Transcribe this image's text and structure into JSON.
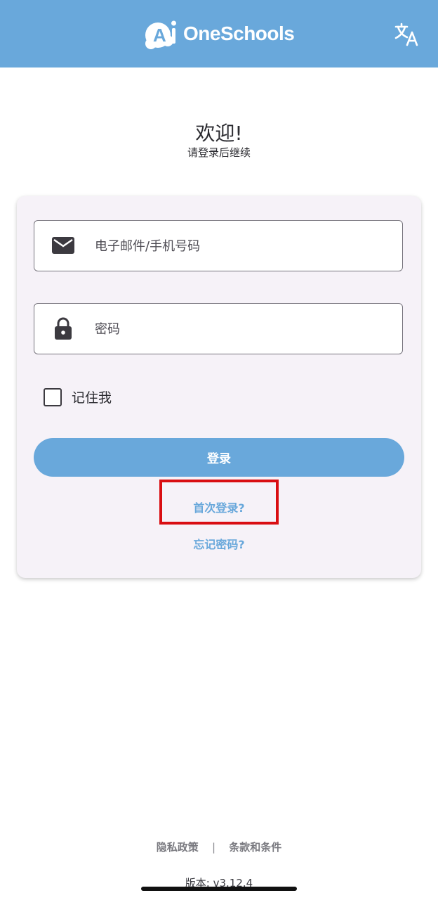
{
  "header": {
    "logo_text": "OneSchools",
    "logo_mark": "Ai",
    "background": "#69a8db",
    "translate_icon": "translate-icon"
  },
  "welcome": {
    "title": "欢迎!",
    "subtitle": "请登录后继续"
  },
  "form": {
    "email_placeholder": "电子邮件/手机号码",
    "email_value": "",
    "email_icon": "envelope-icon",
    "password_placeholder": "密码",
    "password_value": "",
    "password_icon": "lock-icon",
    "remember_label": "记住我",
    "remember_checked": false,
    "login_label": "登录",
    "first_login_label": "首次登录?",
    "forgot_password_label": "忘记密码?"
  },
  "footer": {
    "privacy_label": "隐私政策",
    "separator": "|",
    "terms_label": "条款和条件",
    "version_text": "版本: v3.12.4"
  },
  "colors": {
    "accent": "#69a8db",
    "highlight": "#d90e12",
    "card": "#f6f2f8"
  }
}
